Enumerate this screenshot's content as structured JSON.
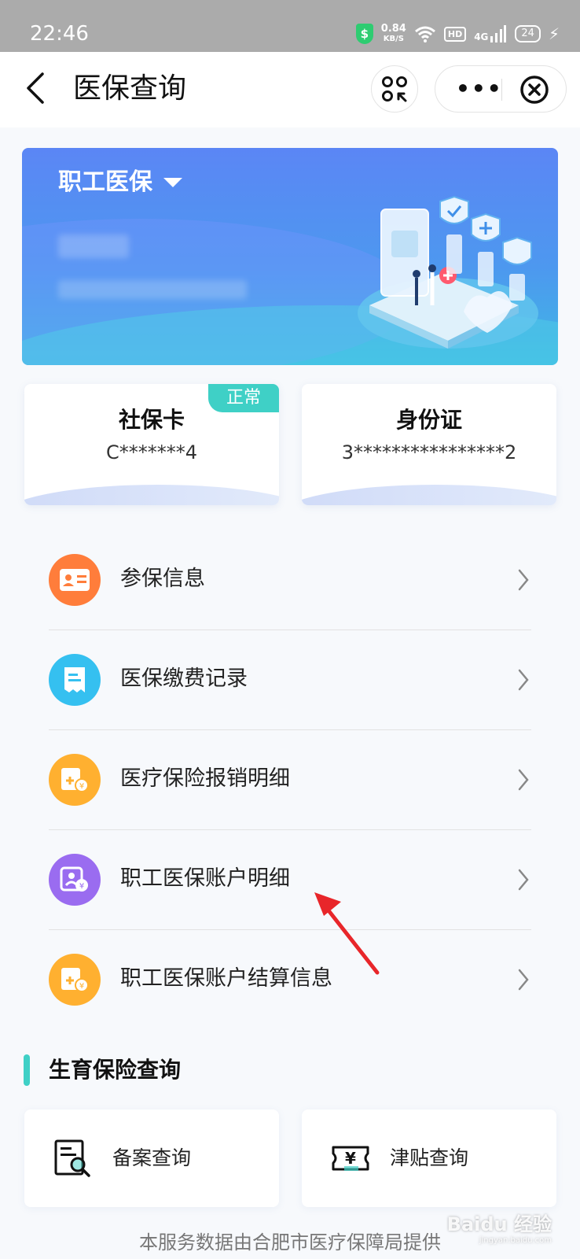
{
  "status_bar": {
    "time": "22:46",
    "net_speed": "0.84",
    "net_unit": "KB/S",
    "hd": "HD",
    "signal": "4G",
    "battery": "24"
  },
  "navbar": {
    "title": "医保查询"
  },
  "banner": {
    "title": "职工医保"
  },
  "cards": [
    {
      "title": "社保卡",
      "value": "C*******4",
      "badge": "正常"
    },
    {
      "title": "身份证",
      "value": "3****************2"
    }
  ],
  "menu": [
    {
      "label": "参保信息",
      "icon": "id-card-icon",
      "color": "#ff7d3b"
    },
    {
      "label": "医保缴费记录",
      "icon": "receipt-icon",
      "color": "#35c0f0"
    },
    {
      "label": "医疗保险报销明细",
      "icon": "reimbursement-icon",
      "color": "#ffb030"
    },
    {
      "label": "职工医保账户明细",
      "icon": "account-icon",
      "color": "#9a6cf0"
    },
    {
      "label": "职工医保账户结算信息",
      "icon": "settlement-icon",
      "color": "#ffb030"
    }
  ],
  "section": {
    "title": "生育保险查询"
  },
  "queries": [
    {
      "label": "备案查询",
      "icon": "document-search-icon"
    },
    {
      "label": "津贴查询",
      "icon": "allowance-ticket-icon"
    }
  ],
  "footer": {
    "text": "本服务数据由合肥市医疗保障局提供"
  },
  "watermark": {
    "text": "Baidu 经验",
    "sub": "jingyan.baidu.com"
  },
  "colors": {
    "accent_teal": "#3fd0c6",
    "banner_blue": "#5b86f5",
    "annotation_arrow": "#e8262a"
  }
}
